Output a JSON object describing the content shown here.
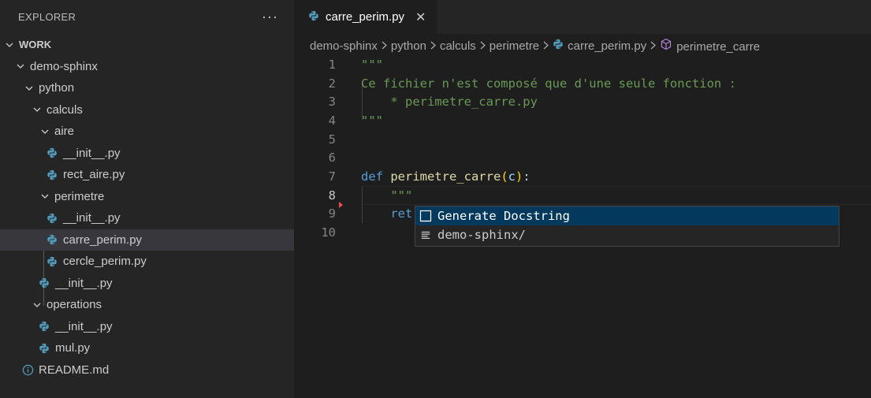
{
  "sidebar": {
    "title": "EXPLORER",
    "more": "···",
    "tree": [
      {
        "label": "WORK",
        "depth": 0,
        "type": "folder",
        "bold": true
      },
      {
        "label": "demo-sphinx",
        "depth": 1,
        "type": "folder"
      },
      {
        "label": "python",
        "depth": 2,
        "type": "folder"
      },
      {
        "label": "calculs",
        "depth": 3,
        "type": "folder"
      },
      {
        "label": "aire",
        "depth": 4,
        "type": "folder"
      },
      {
        "label": "__init__.py",
        "depth": 5,
        "type": "py"
      },
      {
        "label": "rect_aire.py",
        "depth": 5,
        "type": "py"
      },
      {
        "label": "perimetre",
        "depth": 4,
        "type": "folder"
      },
      {
        "label": "__init__.py",
        "depth": 5,
        "type": "py"
      },
      {
        "label": "carre_perim.py",
        "depth": 5,
        "type": "py",
        "selected": true
      },
      {
        "label": "cercle_perim.py",
        "depth": 5,
        "type": "py"
      },
      {
        "label": "__init__.py",
        "depth": 4,
        "type": "py"
      },
      {
        "label": "operations",
        "depth": 3,
        "type": "folder"
      },
      {
        "label": "__init__.py",
        "depth": 4,
        "type": "py"
      },
      {
        "label": "mul.py",
        "depth": 4,
        "type": "py"
      },
      {
        "label": "README.md",
        "depth": 2,
        "type": "info"
      }
    ]
  },
  "tab": {
    "label": "carre_perim.py",
    "close": "✕"
  },
  "breadcrumb": {
    "items": [
      "demo-sphinx",
      "python",
      "calculs",
      "perimetre"
    ],
    "file": "carre_perim.py",
    "symbol": "perimetre_carre"
  },
  "code": {
    "lines": [
      {
        "n": "1",
        "tokens": [
          [
            "str",
            "\"\"\""
          ]
        ]
      },
      {
        "n": "2",
        "tokens": [
          [
            "str",
            "Ce fichier n'est composé que d'une seule fonction :"
          ]
        ]
      },
      {
        "n": "3",
        "tokens": [
          [
            "str",
            "    * perimetre_carre.py"
          ]
        ]
      },
      {
        "n": "4",
        "tokens": [
          [
            "str",
            "\"\"\""
          ]
        ]
      },
      {
        "n": "5",
        "tokens": []
      },
      {
        "n": "6",
        "tokens": []
      },
      {
        "n": "7",
        "tokens": [
          [
            "kw",
            "def "
          ],
          [
            "fn",
            "perimetre_carre"
          ],
          [
            "par",
            "("
          ],
          [
            "var",
            "c"
          ],
          [
            "par",
            ")"
          ],
          [
            "plain",
            ":"
          ]
        ]
      },
      {
        "n": "8",
        "tokens": [
          [
            "plain",
            "    "
          ],
          [
            "str",
            "\"\"\""
          ]
        ],
        "active": true
      },
      {
        "n": "9",
        "tokens": [
          [
            "plain",
            "    "
          ],
          [
            "kw",
            "ret"
          ]
        ]
      },
      {
        "n": "10",
        "tokens": []
      }
    ]
  },
  "suggest": {
    "items": [
      {
        "label": "Generate Docstring",
        "icon": "snippet-icon",
        "focused": true
      },
      {
        "label": "demo-sphinx/",
        "icon": "text-icon",
        "focused": false
      }
    ]
  },
  "colors": {
    "python_blue": "#519aba",
    "selection": "#04395e",
    "accent_red": "#f14c4c"
  }
}
